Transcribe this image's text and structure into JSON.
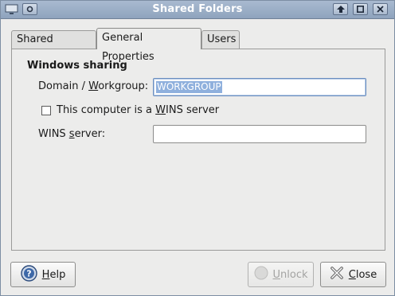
{
  "window": {
    "title": "Shared Folders"
  },
  "tabs": [
    {
      "label": "Shared Folders",
      "active": false
    },
    {
      "label": "General Properties",
      "active": true
    },
    {
      "label": "Users",
      "active": false
    }
  ],
  "windows_sharing": {
    "heading": "Windows sharing",
    "domain_label_pre": "Domain / ",
    "domain_label_mnemonic": "W",
    "domain_label_post": "orkgroup:",
    "domain_value": "WORKGROUP",
    "wins_checkbox_pre": "This computer is a ",
    "wins_checkbox_mnemonic": "W",
    "wins_checkbox_post": "INS server",
    "wins_checked": false,
    "wins_server_pre": "WINS ",
    "wins_server_mnemonic": "s",
    "wins_server_post": "erver:",
    "wins_server_value": ""
  },
  "buttons": {
    "help_mnemonic": "H",
    "help_rest": "elp",
    "unlock_mnemonic": "U",
    "unlock_rest": "nlock",
    "close_mnemonic": "C",
    "close_rest": "lose"
  },
  "icons": {
    "window_menu": "monitor-icon",
    "roll_up": "arrow-up-icon",
    "maximize": "maximize-icon",
    "close": "close-icon",
    "help": "help-icon",
    "unlock": "unlock-icon",
    "close_button": "close-x-icon"
  }
}
